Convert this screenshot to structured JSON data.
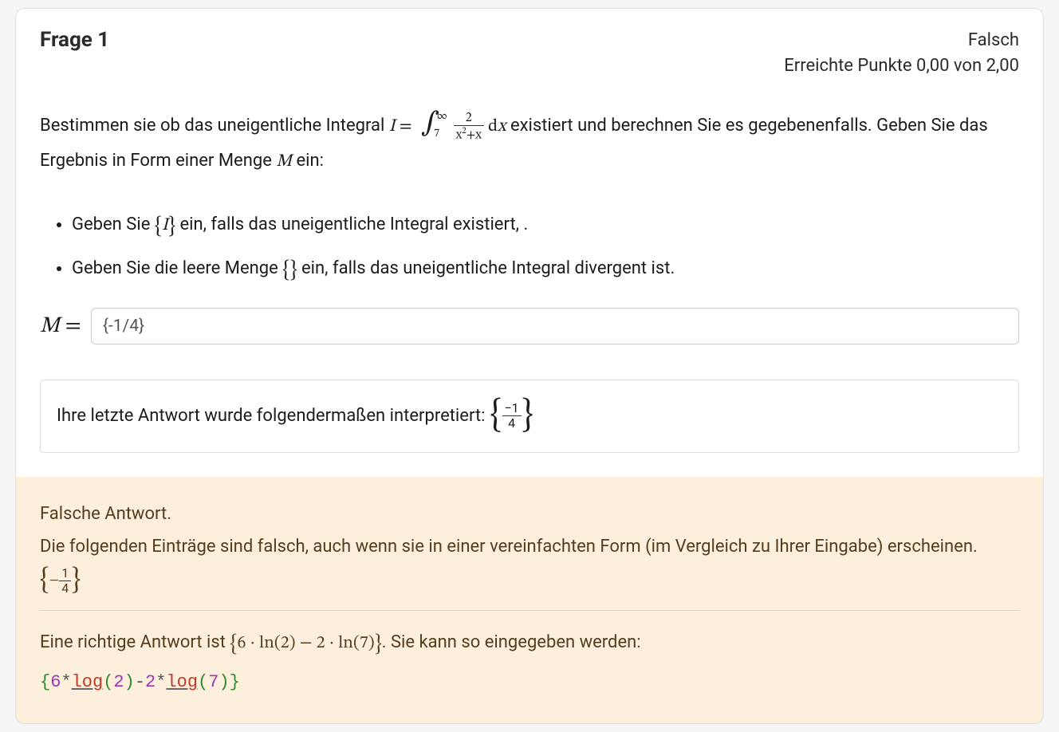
{
  "header": {
    "title": "Frage 1",
    "status": "Falsch",
    "score_line": "Erreichte Punkte 0,00 von 2,00"
  },
  "prompt": {
    "part1": "Bestimmen sie ob das uneigentliche Integral ",
    "formula_I": "I",
    "formula_eq": " = ",
    "int_lower": "7",
    "int_upper": "∞",
    "frac_num": "2",
    "frac_den_left": "x",
    "frac_den_sup": "2",
    "frac_den_right": "+x",
    "dx": " dx",
    "part2": " existiert und berechnen Sie es gegebenenfalls. Geben Sie das Ergebnis in Form einer Menge ",
    "M": "M",
    "part3": " ein:"
  },
  "instructions": {
    "item1a": "Geben Sie ",
    "item1b": " ein, falls das uneigentliche Integral existiert, .",
    "set_I": "I",
    "item2a": "Geben Sie die leere Menge ",
    "item2b": " ein, falls das uneigentliche Integral divergent ist.",
    "empty_set": "{}"
  },
  "answer": {
    "label": "M =",
    "value": "{-1/4}"
  },
  "interpretation": {
    "text": "Ihre letzte Antwort wurde folgendermaßen interpretiert: ",
    "num": "−1",
    "den": "4"
  },
  "feedback": {
    "wrong": "Falsche Antwort.",
    "explain": "Die folgenden Einträge sind falsch, auch wenn sie in einer vereinfachten Form (im Vergleich zu Ihrer Eingabe) erscheinen. ",
    "wrong_num": "1",
    "wrong_den": "4",
    "wrong_sign": "− ",
    "correct_pre": "Eine richtige Antwort ist ",
    "correct_expr": "6 · ln(2) − 2 · ln(7)",
    "correct_post": ". Sie kann so eingegeben werden:",
    "code": {
      "ob": "{",
      "cb": "}",
      "n6": "6",
      "n2a": "2",
      "n2b": "2",
      "n7": "7",
      "star": "*",
      "minus": "-",
      "log": "log",
      "op": "(",
      "cp": ")"
    }
  }
}
